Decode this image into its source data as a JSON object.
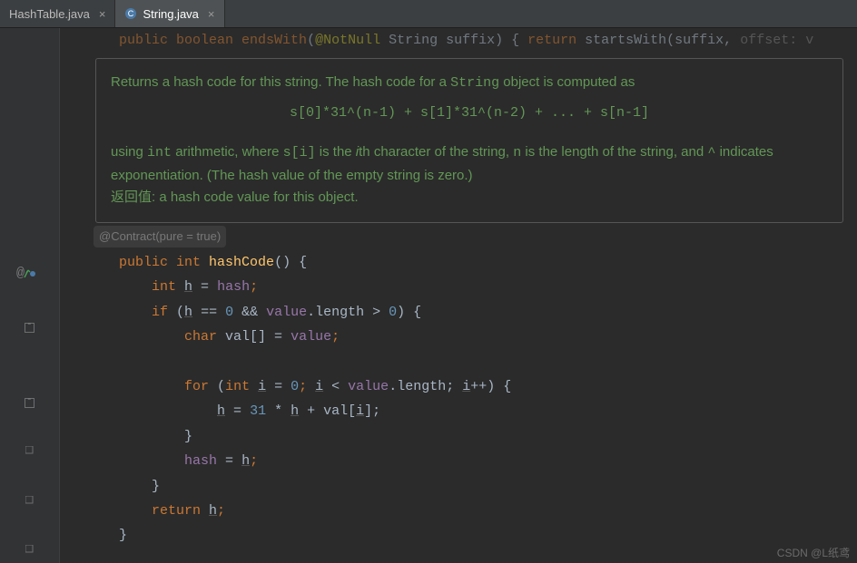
{
  "tabs": [
    {
      "label": "HashTable.java"
    },
    {
      "label": "String.java"
    }
  ],
  "top_code": {
    "pre": "public boolean endsWith",
    "paren": "(",
    "annot": "@NotNull",
    "param": " String suffix",
    "close": ") { ",
    "ret": "return",
    "tail": " startsWith(suffix, ",
    "grey": "offset: v"
  },
  "javadoc": {
    "line1a": "Returns a hash code for this string. The hash code for a ",
    "code1": "String",
    "line1b": " object is computed as",
    "formula": "s[0]*31^(n-1) + s[1]*31^(n-2) + ... + s[n-1]",
    "line2a": "using ",
    "code2": "int",
    "line2b": " arithmetic, where ",
    "code3": "s[i]",
    "line2c": " is the ",
    "ital": "i",
    "line2d": "th character of the string, ",
    "code4": "n",
    "line2e": " is the length of the string, and ",
    "code5": "^",
    "line2f": " indicates exponentiation. (The hash value of the empty string is zero.)",
    "ret_label": "返回值:",
    "ret_text": " a hash code value for this object."
  },
  "inlay": "@Contract(pure = true)",
  "code": {
    "sig_public": "public ",
    "sig_int": "int ",
    "sig_name": "hashCode",
    "sig_tail": "() {",
    "l1_a": "        ",
    "l1_int": "int ",
    "l1_h": "h",
    "l1_eq": " = ",
    "l1_hash": "hash",
    "l1_semi": ";",
    "l2_a": "        ",
    "l2_if": "if ",
    "l2_p": "(",
    "l2_h": "h",
    "l2_eq": " == ",
    "l2_z": "0",
    "l2_and": " && ",
    "l2_val": "value",
    "l2_len": ".length > ",
    "l2_z2": "0",
    "l2_end": ") {",
    "l3_a": "            ",
    "l3_char": "char ",
    "l3_var": "val[] = ",
    "l3_val": "value",
    "l3_semi": ";",
    "l4": "",
    "l5_a": "            ",
    "l5_for": "for ",
    "l5_p": "(",
    "l5_int": "int ",
    "l5_i": "i",
    "l5_e": " = ",
    "l5_z": "0",
    "l5_s": "; ",
    "l5_i2": "i",
    "l5_lt": " < ",
    "l5_val": "value",
    "l5_len": ".length; ",
    "l5_i3": "i",
    "l5_pp": "++) {",
    "l6_a": "                ",
    "l6_h": "h",
    "l6_e": " = ",
    "l6_n": "31",
    "l6_m": " * ",
    "l6_h2": "h",
    "l6_p": " + val[",
    "l6_i": "i",
    "l6_end": "];",
    "l7": "            }",
    "l8_a": "            ",
    "l8_hash": "hash",
    "l8_e": " = ",
    "l8_h": "h",
    "l8_s": ";",
    "l9": "        }",
    "l10_a": "        ",
    "l10_ret": "return ",
    "l10_h": "h",
    "l10_s": ";",
    "l11": "    }"
  },
  "gutter_at": "@",
  "watermark": "CSDN @L纸鸢"
}
